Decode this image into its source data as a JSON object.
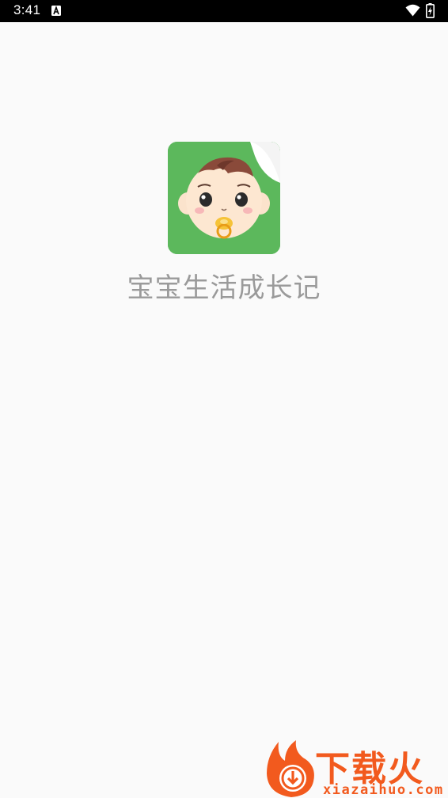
{
  "status_bar": {
    "time": "3:41",
    "notification_icon": "a-icon",
    "wifi_icon": "wifi-icon",
    "battery_icon": "battery-charging-icon"
  },
  "splash": {
    "app_icon": "baby-face-icon",
    "app_name": "宝宝生活成长记",
    "colors": {
      "icon_bg": "#5cb85c",
      "app_name_text": "#9a9a9a",
      "background": "#fafafa"
    }
  },
  "watermark": {
    "logo_icon": "flame-download-icon",
    "title": "下载火",
    "domain": "xiazaihuo.com",
    "color": "#f25a1e"
  }
}
